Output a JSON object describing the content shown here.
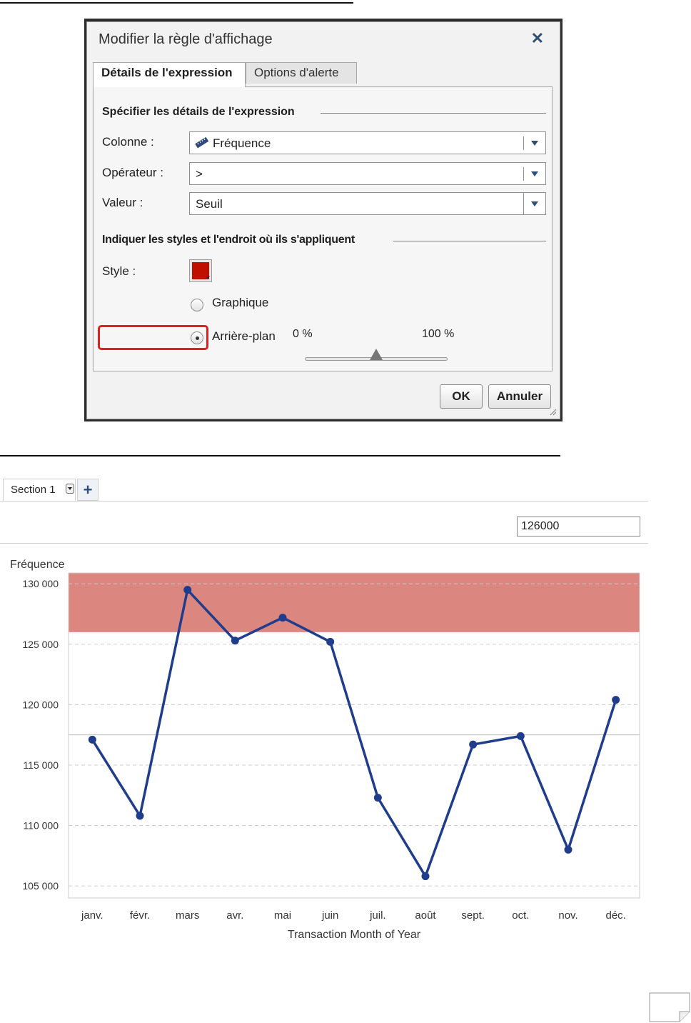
{
  "dialog": {
    "title": "Modifier la règle d'affichage",
    "close_glyph": "✕",
    "tabs": [
      {
        "label": "Détails de l'expression",
        "active": true
      },
      {
        "label": "Options d'alerte",
        "active": false
      }
    ],
    "section_expression": "Spécifier les détails de l'expression",
    "fields": {
      "column": {
        "label": "Colonne :",
        "value": "Fréquence",
        "icon": "measure-ruler-icon"
      },
      "operator": {
        "label": "Opérateur :",
        "value": ">"
      },
      "value": {
        "label": "Valeur :",
        "value": "Seuil"
      }
    },
    "section_styles": "Indiquer les styles et l'endroit où ils s'appliquent",
    "style": {
      "label": "Style :",
      "color": "#c00f00"
    },
    "options": [
      {
        "label": "Graphique",
        "selected": false
      },
      {
        "label": "Arrière-plan",
        "selected": true
      }
    ],
    "transparency": {
      "min_label": "0 %",
      "max_label": "100 %",
      "value_percent": 50
    },
    "buttons": {
      "ok": "OK",
      "cancel": "Annuler"
    }
  },
  "report": {
    "section_tab": "Section 1",
    "add_glyph": "+",
    "threshold_input": "126000"
  },
  "chart_data": {
    "type": "line",
    "ylabel": "Fréquence",
    "xlabel": "Transaction Month of Year",
    "categories": [
      "janv.",
      "févr.",
      "mars",
      "avr.",
      "mai",
      "juin",
      "juil.",
      "août",
      "sept.",
      "oct.",
      "nov.",
      "déc."
    ],
    "series": [
      {
        "values": [
          117100,
          110800,
          129500,
          125300,
          127200,
          125200,
          112300,
          105800,
          116700,
          117400,
          108000,
          120400
        ]
      }
    ],
    "ylim": [
      104000,
      130900
    ],
    "yticks": [
      105000,
      110000,
      115000,
      120000,
      125000,
      130000
    ],
    "ytick_labels": [
      "105 000",
      "110 000",
      "115 000",
      "120 000",
      "125 000",
      "130 000"
    ],
    "reference_line": 117500,
    "threshold_band_from": 126000,
    "colors": {
      "line": "#1f3d8c",
      "band": "#dc8680",
      "grid": "#cccccc",
      "reference": "#bbbbbb"
    },
    "grid": true
  }
}
